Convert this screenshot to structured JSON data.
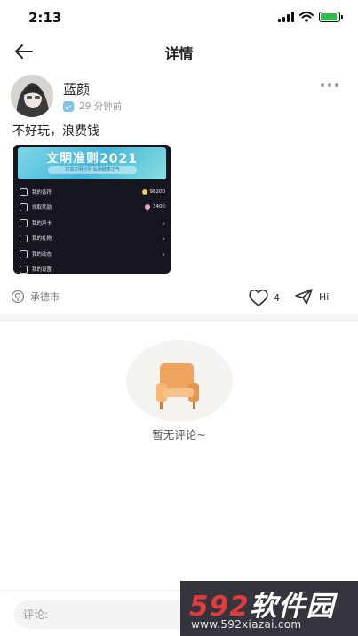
{
  "status_bar": {
    "time": "2:13",
    "battery_level": 0.9
  },
  "nav": {
    "title": "详情"
  },
  "post": {
    "author": "蓝颜",
    "time_ago": "29 分钟前",
    "text": "不好玩，浪费钱",
    "image": {
      "banner_title": "文明准则2021",
      "banner_subtitle": "打造文明社区 弘扬健康正气",
      "menu": [
        {
          "label": "我的音符",
          "value": "98200",
          "coin_color": "#f2c94c"
        },
        {
          "label": "领取奖励",
          "value": "3400",
          "coin_color": "#f6a6d3"
        },
        {
          "label": "我的声卡",
          "value": ""
        },
        {
          "label": "我的礼物",
          "value": ""
        },
        {
          "label": "我的动态",
          "value": ""
        },
        {
          "label": "我的设置",
          "value": ""
        }
      ]
    },
    "location": "承德市",
    "likes": "4",
    "share_label": "Hi"
  },
  "empty_state": {
    "text": "暂无评论~"
  },
  "comment": {
    "placeholder": "评论:"
  },
  "watermark": {
    "logo_num": "592",
    "logo_text": "软件园",
    "url": "www.592xiazai.com"
  },
  "colors": {
    "accent_blue": "#47b6d9",
    "badge_blue": "#7bc3ea",
    "sofa_orange": "#f0a35c"
  }
}
